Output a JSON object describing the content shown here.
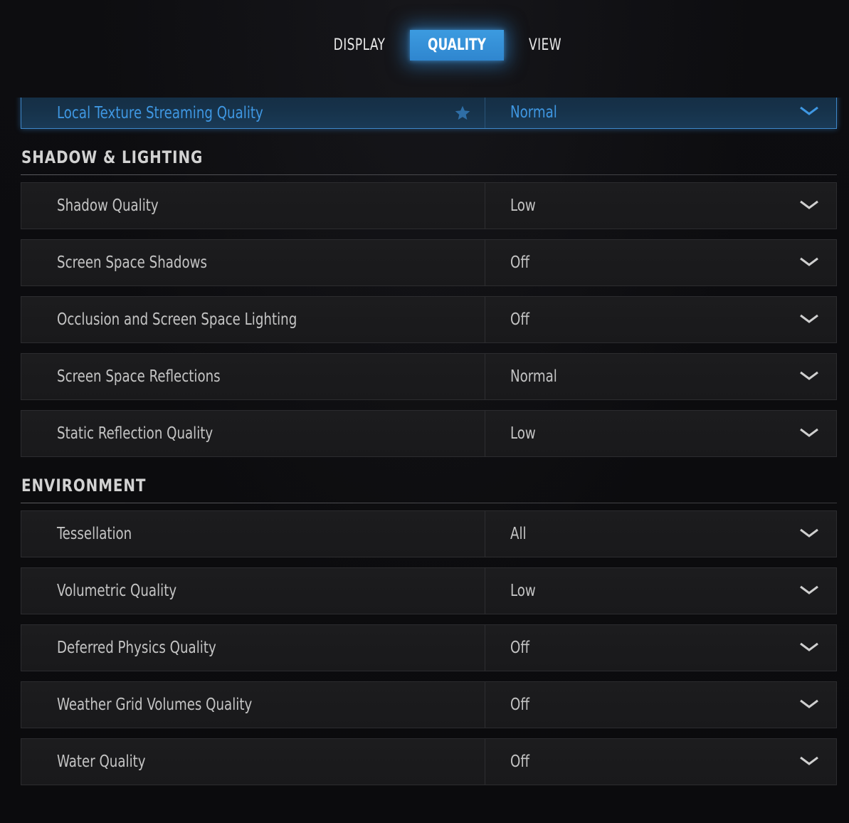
{
  "tabs": {
    "display": "DISPLAY",
    "quality": "QUALITY",
    "view": "VIEW",
    "active": "QUALITY"
  },
  "highlighted_row": {
    "label": "Local Texture Streaming Quality",
    "value": "Normal",
    "icon": "star-icon"
  },
  "sections": [
    {
      "title": "SHADOW & LIGHTING",
      "rows": [
        {
          "label": "Shadow Quality",
          "value": "Low"
        },
        {
          "label": "Screen Space Shadows",
          "value": "Off"
        },
        {
          "label": "Occlusion and Screen Space Lighting",
          "value": "Off"
        },
        {
          "label": "Screen Space Reflections",
          "value": "Normal"
        },
        {
          "label": "Static Reflection Quality",
          "value": "Low"
        }
      ]
    },
    {
      "title": "ENVIRONMENT",
      "rows": [
        {
          "label": "Tessellation",
          "value": "All"
        },
        {
          "label": "Volumetric Quality",
          "value": "Low"
        },
        {
          "label": "Deferred Physics Quality",
          "value": "Off"
        },
        {
          "label": "Weather Grid Volumes Quality",
          "value": "Off"
        },
        {
          "label": "Water Quality",
          "value": "Off"
        }
      ]
    }
  ],
  "colors": {
    "accent": "#3f97e2",
    "tab_active_bg": "#3a96dc",
    "row_bg": "#1b1b1d",
    "text": "#c4c4c4"
  }
}
